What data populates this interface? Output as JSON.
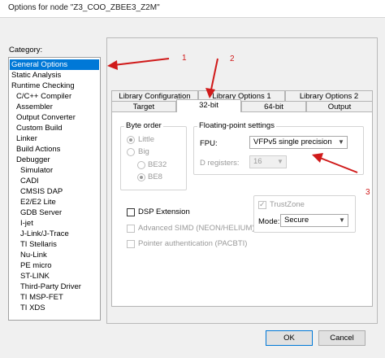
{
  "window": {
    "title": "Options for node \"Z3_COO_ZBEE3_Z2M\""
  },
  "category": {
    "label": "Category:",
    "items": [
      {
        "label": "General Options",
        "level": 0,
        "selected": true
      },
      {
        "label": "Static Analysis",
        "level": 0
      },
      {
        "label": "Runtime Checking",
        "level": 0
      },
      {
        "label": "C/C++ Compiler",
        "level": 1
      },
      {
        "label": "Assembler",
        "level": 1
      },
      {
        "label": "Output Converter",
        "level": 1
      },
      {
        "label": "Custom Build",
        "level": 1
      },
      {
        "label": "Linker",
        "level": 1
      },
      {
        "label": "Build Actions",
        "level": 1
      },
      {
        "label": "Debugger",
        "level": 1
      },
      {
        "label": "Simulator",
        "level": 2
      },
      {
        "label": "CADI",
        "level": 2
      },
      {
        "label": "CMSIS DAP",
        "level": 2
      },
      {
        "label": "E2/E2 Lite",
        "level": 2
      },
      {
        "label": "GDB Server",
        "level": 2
      },
      {
        "label": "I-jet",
        "level": 2
      },
      {
        "label": "J-Link/J-Trace",
        "level": 2
      },
      {
        "label": "TI Stellaris",
        "level": 2
      },
      {
        "label": "Nu-Link",
        "level": 2
      },
      {
        "label": "PE micro",
        "level": 2
      },
      {
        "label": "ST-LINK",
        "level": 2
      },
      {
        "label": "Third-Party Driver",
        "level": 2
      },
      {
        "label": "TI MSP-FET",
        "level": 2
      },
      {
        "label": "TI XDS",
        "level": 2
      }
    ]
  },
  "tabs": {
    "row1": [
      "Library Configuration",
      "Library Options 1",
      "Library Options 2"
    ],
    "row2": [
      "Target",
      "32-bit",
      "64-bit",
      "Output"
    ],
    "active": "32-bit"
  },
  "byte_order": {
    "title": "Byte order",
    "little": "Little",
    "big": "Big",
    "be32": "BE32",
    "be8": "BE8"
  },
  "floating_point": {
    "title": "Floating-point settings",
    "fpu_label": "FPU:",
    "fpu_value": "VFPv5 single precision",
    "dreg_label": "D registers:",
    "dreg_value": "16"
  },
  "options": {
    "dsp": "DSP Extension",
    "simd": "Advanced SIMD (NEON/HELIUM)",
    "pac": "Pointer authentication (PACBTI)"
  },
  "trustzone": {
    "label": "TrustZone",
    "mode_label": "Mode:",
    "mode_value": "Secure"
  },
  "buttons": {
    "ok": "OK",
    "cancel": "Cancel"
  },
  "annotations": {
    "one": "1",
    "two": "2",
    "three": "3",
    "color": "#d01a1a"
  }
}
